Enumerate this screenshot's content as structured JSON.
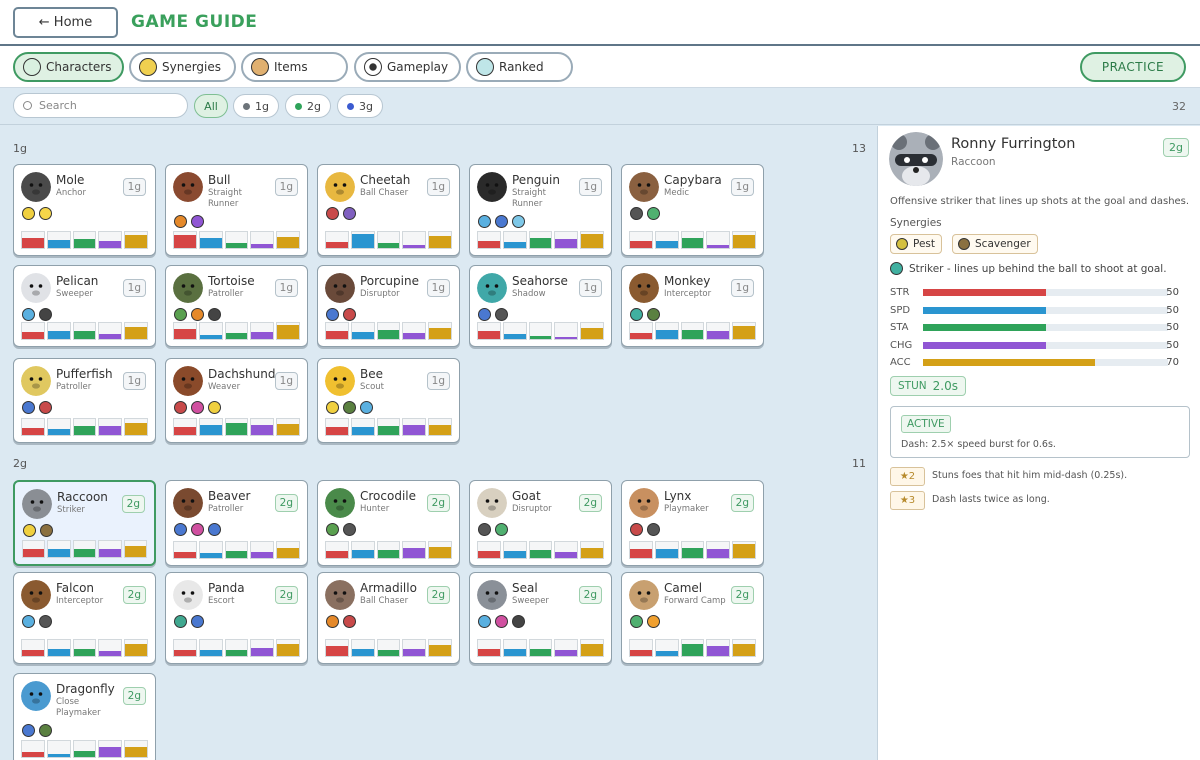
{
  "header": {
    "home_label": "← Home",
    "title": "GAME GUIDE"
  },
  "tabs": [
    {
      "label": "Characters",
      "icon": "character-icon",
      "active": true
    },
    {
      "label": "Synergies",
      "icon": "synergy-icon",
      "active": false
    },
    {
      "label": "Items",
      "icon": "items-icon",
      "active": false
    },
    {
      "label": "Gameplay",
      "icon": "gameplay-icon",
      "active": false
    },
    {
      "label": "Ranked",
      "icon": "ranked-icon",
      "active": false
    }
  ],
  "practice_label": "PRACTICE",
  "filters": {
    "search_placeholder": "Search",
    "pills": [
      {
        "label": "All",
        "dot": null,
        "active": true
      },
      {
        "label": "1g",
        "dot": "#6d747a"
      },
      {
        "label": "2g",
        "dot": "#2fa35a"
      },
      {
        "label": "3g",
        "dot": "#3b5bd0"
      }
    ],
    "total": "32"
  },
  "stat_colors": [
    "#d64545",
    "#2a95d0",
    "#2fa35a",
    "#9056d4",
    "#d4a017"
  ],
  "groups": [
    {
      "label": "1g",
      "count": "13",
      "characters": [
        {
          "name": "Mole",
          "role": "Anchor",
          "cost": "1g",
          "color": "#4a4a4a",
          "syn": [
            "#f0d040",
            "#f5d64a"
          ],
          "stats": [
            60,
            50,
            55,
            45,
            80
          ]
        },
        {
          "name": "Bull",
          "role": "Straight Runner",
          "cost": "1g",
          "color": "#8a4a30",
          "syn": [
            "#e5892a",
            "#9056d4"
          ],
          "stats": [
            80,
            65,
            30,
            25,
            70
          ]
        },
        {
          "name": "Cheetah",
          "role": "Ball Chaser",
          "cost": "1g",
          "color": "#e8b840",
          "syn": [
            "#c84a4a",
            "#8060c0"
          ],
          "stats": [
            40,
            85,
            30,
            20,
            75
          ]
        },
        {
          "name": "Penguin",
          "role": "Straight Runner",
          "cost": "1g",
          "color": "#2a2a2a",
          "syn": [
            "#5ab0e0",
            "#4a78d0",
            "#7ec8e8"
          ],
          "stats": [
            45,
            35,
            65,
            55,
            85
          ]
        },
        {
          "name": "Capybara",
          "role": "Medic",
          "cost": "1g",
          "color": "#8a6040",
          "syn": [
            "#555",
            "#50b070"
          ],
          "stats": [
            45,
            45,
            65,
            20,
            80
          ]
        },
        {
          "name": "Pelican",
          "role": "Sweeper",
          "cost": "1g",
          "color": "#e0e2e6",
          "syn": [
            "#5ab0e0",
            "#444"
          ],
          "stats": [
            45,
            50,
            50,
            30,
            75
          ]
        },
        {
          "name": "Tortoise",
          "role": "Patroller",
          "cost": "1g",
          "color": "#5a7040",
          "syn": [
            "#5aa050",
            "#e5892a",
            "#444"
          ],
          "stats": [
            60,
            25,
            40,
            45,
            85
          ]
        },
        {
          "name": "Porcupine",
          "role": "Disruptor",
          "cost": "1g",
          "color": "#6a4a3a",
          "syn": [
            "#4a78d0",
            "#c84a4a"
          ],
          "stats": [
            50,
            45,
            55,
            40,
            70
          ]
        },
        {
          "name": "Seahorse",
          "role": "Shadow",
          "cost": "1g",
          "color": "#40a8a8",
          "syn": [
            "#4a78d0",
            "#555"
          ],
          "stats": [
            50,
            30,
            20,
            10,
            70
          ]
        },
        {
          "name": "Monkey",
          "role": "Interceptor",
          "cost": "1g",
          "color": "#8a5a30",
          "syn": [
            "#40b0a0",
            "#5a8040"
          ],
          "stats": [
            35,
            55,
            55,
            50,
            80
          ]
        },
        {
          "name": "Pufferfish",
          "role": "Patroller",
          "cost": "1g",
          "color": "#e0c860",
          "syn": [
            "#4a78d0",
            "#c84a4a"
          ],
          "stats": [
            45,
            35,
            55,
            55,
            75
          ]
        },
        {
          "name": "Dachshund",
          "role": "Weaver",
          "cost": "1g",
          "color": "#8a4a2a",
          "syn": [
            "#c84a4a",
            "#d050a0",
            "#f0d040"
          ],
          "stats": [
            50,
            60,
            75,
            60,
            70
          ]
        },
        {
          "name": "Bee",
          "role": "Scout",
          "cost": "1g",
          "color": "#f0c030",
          "syn": [
            "#f0d040",
            "#5a8040",
            "#5ab0e0"
          ],
          "stats": [
            50,
            50,
            55,
            60,
            65
          ]
        }
      ]
    },
    {
      "label": "2g",
      "count": "11",
      "characters": [
        {
          "name": "Raccoon",
          "role": "Striker",
          "cost": "2g",
          "color": "#8a8e94",
          "syn": [
            "#f0d040",
            "#8a7040"
          ],
          "stats": [
            50,
            50,
            50,
            50,
            70
          ],
          "selected": true
        },
        {
          "name": "Beaver",
          "role": "Patroller",
          "cost": "2g",
          "color": "#7a4a30",
          "syn": [
            "#4a78d0",
            "#d050a0",
            "#4a78d0"
          ],
          "stats": [
            40,
            30,
            45,
            40,
            65
          ]
        },
        {
          "name": "Crocodile",
          "role": "Hunter",
          "cost": "2g",
          "color": "#4a8a4a",
          "syn": [
            "#5aa050",
            "#555"
          ],
          "stats": [
            45,
            50,
            50,
            60,
            70
          ]
        },
        {
          "name": "Goat",
          "role": "Disruptor",
          "cost": "2g",
          "color": "#d8d0c0",
          "syn": [
            "#555",
            "#50b070"
          ],
          "stats": [
            45,
            45,
            50,
            40,
            60
          ]
        },
        {
          "name": "Lynx",
          "role": "Playmaker",
          "cost": "2g",
          "color": "#c89060",
          "syn": [
            "#c84a4a",
            "#555"
          ],
          "stats": [
            55,
            55,
            60,
            55,
            85
          ]
        },
        {
          "name": "Falcon",
          "role": "Interceptor",
          "cost": "2g",
          "color": "#8a5a30",
          "syn": [
            "#5ab0e0",
            "#555"
          ],
          "stats": [
            35,
            45,
            45,
            30,
            75
          ]
        },
        {
          "name": "Panda",
          "role": "Escort",
          "cost": "2g",
          "color": "#e8e8e8",
          "syn": [
            "#40a890",
            "#4a78d0"
          ],
          "stats": [
            40,
            40,
            35,
            50,
            75
          ]
        },
        {
          "name": "Armadillo",
          "role": "Ball Chaser",
          "cost": "2g",
          "color": "#8a7060",
          "syn": [
            "#e5892a",
            "#c84a4a"
          ],
          "stats": [
            60,
            45,
            40,
            45,
            70
          ]
        },
        {
          "name": "Seal",
          "role": "Sweeper",
          "cost": "2g",
          "color": "#8a9098",
          "syn": [
            "#5ab0e0",
            "#d050a0",
            "#444"
          ],
          "stats": [
            45,
            45,
            45,
            40,
            75
          ]
        },
        {
          "name": "Camel",
          "role": "Forward Camp",
          "cost": "2g",
          "color": "#c8a070",
          "syn": [
            "#50b070",
            "#f0a030"
          ],
          "stats": [
            40,
            30,
            75,
            60,
            75
          ]
        },
        {
          "name": "Dragonfly",
          "role": "Close Playmaker",
          "cost": "2g",
          "color": "#4a9ad0",
          "syn": [
            "#4a78d0",
            "#5a8040"
          ],
          "stats": [
            30,
            20,
            35,
            60,
            65
          ]
        }
      ]
    }
  ],
  "detail": {
    "name": "Ronny Furrington",
    "species": "Raccoon",
    "cost": "2g",
    "description": "Offensive striker that lines up shots at the goal and dashes.",
    "synergies_label": "Synergies",
    "synergies": [
      {
        "label": "Pest",
        "icon": "pest-icon",
        "color": "#d4c040"
      },
      {
        "label": "Scavenger",
        "icon": "scavenger-icon",
        "color": "#8a7040"
      }
    ],
    "class_text": "Striker  -  lines up behind the ball to shoot at goal.",
    "stats": [
      {
        "label": "STR",
        "value": 50
      },
      {
        "label": "SPD",
        "value": 50
      },
      {
        "label": "STA",
        "value": 50
      },
      {
        "label": "CHG",
        "value": 50
      },
      {
        "label": "ACC",
        "value": 70
      }
    ],
    "stun_label": "STUN",
    "stun_value": "2.0s",
    "active_label": "ACTIVE",
    "active_text": "Dash: 2.5× speed burst for 0.6s.",
    "levels": [
      {
        "tag": "★2",
        "text": "Stuns foes that hit him mid-dash (0.25s)."
      },
      {
        "tag": "★3",
        "text": "Dash lasts twice as long."
      }
    ]
  }
}
